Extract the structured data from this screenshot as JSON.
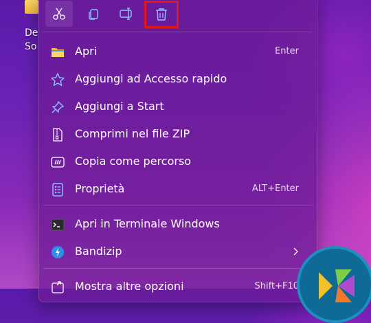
{
  "desktop": {
    "icon_label": "De\nSo"
  },
  "toolbar": {
    "cut_icon": "scissors-icon",
    "copy_icon": "copy-icon",
    "rename_icon": "rename-icon",
    "delete_icon": "trash-icon",
    "highlight_color": "#e0171d"
  },
  "menu": {
    "items": [
      {
        "label": "Apri",
        "shortcut": "Enter",
        "icon": "folder-icon"
      },
      {
        "label": "Aggiungi ad Accesso rapido",
        "shortcut": "",
        "icon": "star-icon"
      },
      {
        "label": "Aggiungi a Start",
        "shortcut": "",
        "icon": "pin-icon"
      },
      {
        "label": "Comprimi nel file ZIP",
        "shortcut": "",
        "icon": "zip-icon"
      },
      {
        "label": "Copia come percorso",
        "shortcut": "",
        "icon": "path-icon"
      },
      {
        "label": "Proprietà",
        "shortcut": "ALT+Enter",
        "icon": "properties-icon"
      },
      {
        "label": "Apri in Terminale Windows",
        "shortcut": "",
        "icon": "terminal-icon"
      },
      {
        "label": "Bandizip",
        "shortcut": "",
        "icon": "bandizip-icon",
        "submenu": true
      },
      {
        "label": "Mostra altre opzioni",
        "shortcut": "Shift+F10",
        "icon": "more-options-icon"
      }
    ]
  },
  "colors": {
    "accent": "#6fb6ff",
    "menu_bg": "#6e1c96"
  },
  "watermark": {
    "icon": "logo-watermark-icon"
  }
}
